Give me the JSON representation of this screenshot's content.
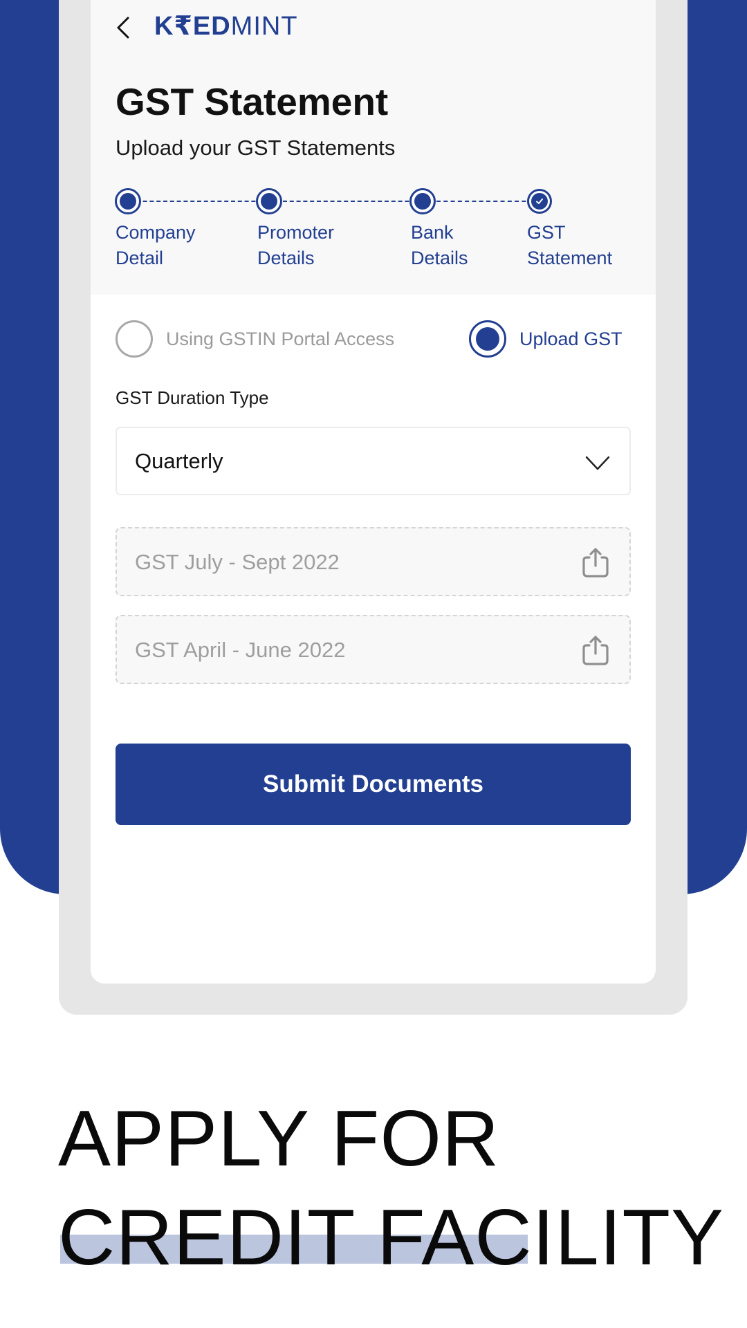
{
  "brand": {
    "logo_bold": "K₹ED",
    "logo_light": "MINT",
    "primary_color": "#223f91"
  },
  "header": {
    "back_icon": "chevron-left-icon",
    "title": "GST Statement",
    "subtitle": "Upload your GST Statements"
  },
  "stepper": {
    "steps": [
      {
        "line1": "Company",
        "line2": "Detail",
        "state": "completed"
      },
      {
        "line1": "Promoter",
        "line2": "Details",
        "state": "completed"
      },
      {
        "line1": "Bank",
        "line2": "Details",
        "state": "completed"
      },
      {
        "line1": "GST",
        "line2": "Statement",
        "state": "current"
      }
    ]
  },
  "source_options": [
    {
      "label": "Using GSTIN Portal Access",
      "selected": false
    },
    {
      "label": "Upload GST",
      "selected": true
    }
  ],
  "duration": {
    "label": "GST Duration Type",
    "selected": "Quarterly",
    "icon": "chevron-down-icon"
  },
  "uploads": [
    {
      "placeholder": "GST July - Sept 2022",
      "icon": "upload-icon"
    },
    {
      "placeholder": "GST April - June 2022",
      "icon": "upload-icon"
    }
  ],
  "submit_label": "Submit Documents",
  "promo": {
    "line1": "APPLY FOR",
    "line2": "CREDIT FACILITY"
  }
}
